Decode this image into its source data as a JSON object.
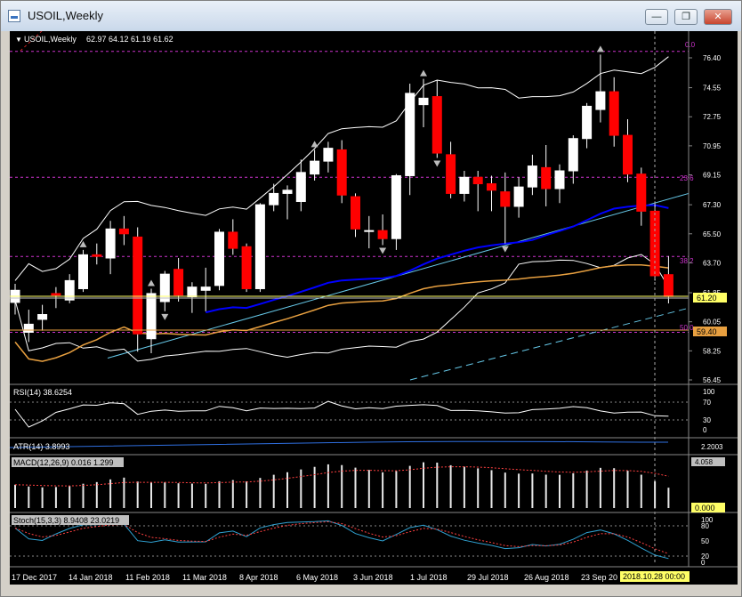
{
  "window": {
    "title": "USOIL,Weekly",
    "minimize_glyph": "—",
    "restore_glyph": "❐",
    "close_glyph": "✕"
  },
  "header": {
    "symbol": "USOIL,Weekly",
    "ohlc": "62.97 64.12 61.19 61.62",
    "menu_glyph": "▼"
  },
  "fib_labels": {
    "f0": "0.0",
    "f236": "23.6",
    "f382": "38.2",
    "f50": "50.0"
  },
  "price_ticks": [
    "76.40",
    "74.55",
    "72.75",
    "70.95",
    "69.15",
    "67.30",
    "65.50",
    "63.70",
    "61.85",
    "60.05",
    "58.25",
    "56.45"
  ],
  "price_badges": {
    "current": "61.20",
    "fifty": "59.40"
  },
  "rsi": {
    "label": "RSI(14) 38.6254",
    "ticks": [
      "100",
      "70",
      "30",
      "0"
    ]
  },
  "atr": {
    "label": "ATR(14) 3.8993",
    "tick": "2.2003"
  },
  "macd": {
    "label": "MACD(12,26,9) 0.016 1.299",
    "top_tick": "4.058",
    "zero_tick": "0.000"
  },
  "stoch": {
    "label": "Stoch(15,3,3) 8.9408 23.0219",
    "ticks": [
      "100",
      "80",
      "50",
      "20",
      "0"
    ]
  },
  "time_axis": {
    "labels": [
      "17 Dec 2017",
      "14 Jan 2018",
      "11 Feb 2018",
      "11 Mar 2018",
      "8 Apr 2018",
      "6 May 2018",
      "3 Jun 2018",
      "1 Jul 2018",
      "29 Jul 2018",
      "26 Aug 2018",
      "23 Sep 20"
    ],
    "cursor_date": "2018.10.28 00:00"
  },
  "colors": {
    "bull": "#ffffff",
    "bear": "#ff0000",
    "fib": "#cc33cc",
    "ma_blue": "#0000ff",
    "ma_orange": "#e8a040",
    "trend": "#66c8e8",
    "bands": "#ffffff"
  },
  "candles": [
    [
      61.25,
      62.4,
      60.5,
      62.0
    ],
    [
      59.4,
      60.8,
      58.8,
      59.9
    ],
    [
      60.2,
      61.1,
      59.5,
      60.5
    ],
    [
      61.8,
      62.2,
      60.9,
      61.7
    ],
    [
      61.4,
      63.0,
      61.2,
      62.6
    ],
    [
      62.1,
      64.5,
      61.9,
      64.2
    ],
    [
      64.2,
      64.9,
      63.6,
      64.1
    ],
    [
      64.0,
      66.3,
      63.0,
      65.8
    ],
    [
      65.8,
      66.6,
      64.8,
      65.5
    ],
    [
      65.3,
      65.9,
      58.2,
      59.3
    ],
    [
      59.0,
      62.1,
      58.1,
      61.8
    ],
    [
      61.3,
      63.2,
      60.7,
      63.0
    ],
    [
      63.3,
      64.0,
      61.3,
      61.7
    ],
    [
      61.6,
      62.5,
      60.6,
      62.2
    ],
    [
      62.0,
      63.4,
      60.7,
      62.2
    ],
    [
      62.3,
      65.8,
      62.0,
      65.6
    ],
    [
      65.6,
      66.4,
      64.2,
      64.6
    ],
    [
      64.7,
      64.9,
      61.9,
      62.1
    ],
    [
      62.1,
      67.4,
      61.9,
      67.3
    ],
    [
      67.3,
      68.6,
      66.9,
      68.0
    ],
    [
      68.0,
      68.5,
      66.4,
      68.2
    ],
    [
      67.5,
      70.1,
      66.9,
      69.3
    ],
    [
      69.2,
      70.7,
      68.8,
      70.0
    ],
    [
      70.0,
      71.2,
      69.3,
      70.8
    ],
    [
      70.7,
      71.3,
      67.4,
      67.9
    ],
    [
      67.8,
      68.0,
      65.3,
      65.8
    ],
    [
      65.7,
      66.6,
      64.6,
      65.7
    ],
    [
      65.7,
      66.7,
      64.8,
      65.2
    ],
    [
      65.2,
      69.2,
      64.5,
      69.1
    ],
    [
      69.1,
      74.8,
      67.9,
      74.2
    ],
    [
      73.5,
      75.1,
      72.1,
      73.9
    ],
    [
      74.0,
      75.0,
      70.2,
      70.5
    ],
    [
      70.4,
      71.2,
      67.7,
      68.0
    ],
    [
      68.0,
      69.4,
      67.5,
      69.0
    ],
    [
      69.0,
      69.4,
      66.9,
      68.6
    ],
    [
      68.6,
      69.1,
      66.9,
      68.2
    ],
    [
      68.1,
      69.3,
      64.9,
      67.2
    ],
    [
      67.2,
      69.0,
      66.5,
      68.4
    ],
    [
      68.4,
      70.4,
      67.9,
      69.7
    ],
    [
      69.6,
      71.0,
      67.2,
      68.3
    ],
    [
      68.3,
      69.8,
      67.4,
      69.4
    ],
    [
      69.4,
      71.6,
      68.6,
      71.4
    ],
    [
      71.4,
      73.6,
      70.8,
      73.4
    ],
    [
      73.2,
      76.6,
      72.4,
      74.3
    ],
    [
      74.3,
      75.2,
      70.9,
      71.6
    ],
    [
      71.6,
      72.6,
      68.7,
      69.2
    ],
    [
      69.2,
      69.6,
      66.0,
      66.9
    ],
    [
      66.9,
      67.5,
      62.6,
      62.9
    ],
    [
      62.97,
      64.12,
      61.19,
      61.62
    ]
  ]
}
